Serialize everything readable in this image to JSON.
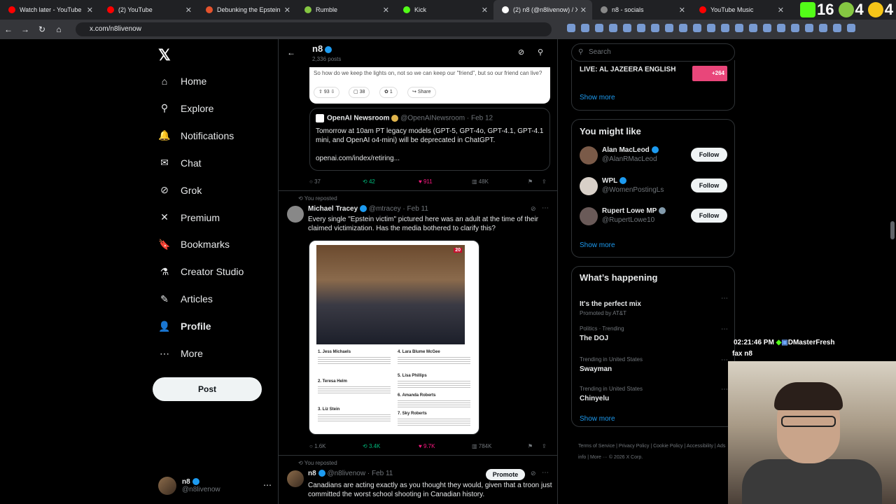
{
  "tabs": [
    {
      "label": "Watch later - YouTube",
      "color": "#ff0000"
    },
    {
      "label": "(2) YouTube",
      "color": "#ff0000"
    },
    {
      "label": "Debunking the Epstein My",
      "color": "#e5532d"
    },
    {
      "label": "Rumble",
      "color": "#85c742"
    },
    {
      "label": "Kick",
      "color": "#53fc18"
    },
    {
      "label": "(2) n8 (@n8livenow) / X",
      "color": "#ffffff",
      "active": true
    },
    {
      "label": "n8 - socials",
      "color": "#888888"
    },
    {
      "label": "YouTube Music",
      "color": "#ff0000"
    }
  ],
  "stream_counts": {
    "kick": "16",
    "rumble": "4",
    "other": "4"
  },
  "url": "x.com/n8livenow",
  "sidebar": {
    "items": [
      {
        "label": "Home",
        "icon": "home-icon",
        "glyph": "⌂"
      },
      {
        "label": "Explore",
        "icon": "search-icon",
        "glyph": "⚲"
      },
      {
        "label": "Notifications",
        "icon": "bell-icon",
        "glyph": "🔔",
        "badge": "2"
      },
      {
        "label": "Chat",
        "icon": "mail-icon",
        "glyph": "✉"
      },
      {
        "label": "Grok",
        "icon": "grok-icon",
        "glyph": "⊘"
      },
      {
        "label": "Premium",
        "icon": "x-icon",
        "glyph": "✕"
      },
      {
        "label": "Bookmarks",
        "icon": "bookmark-icon",
        "glyph": "🔖"
      },
      {
        "label": "Creator Studio",
        "icon": "flask-icon",
        "glyph": "⚗"
      },
      {
        "label": "Articles",
        "icon": "article-icon",
        "glyph": "✎"
      },
      {
        "label": "Profile",
        "icon": "person-icon",
        "glyph": "👤",
        "bold": true
      },
      {
        "label": "More",
        "icon": "more-icon",
        "glyph": "⋯"
      }
    ],
    "post_label": "Post",
    "account": {
      "name": "n8",
      "handle": "@n8livenow"
    }
  },
  "header": {
    "title": "n8",
    "subtitle": "2,336 posts"
  },
  "card_question": "So how do we keep the lights on, not so we can keep our \"friend\", but so our friend can live?",
  "card_pills": {
    "votes": "93",
    "comments": "38",
    "reacts": "1",
    "share": "Share"
  },
  "quote": {
    "name": "OpenAI Newsroom",
    "handle": "@OpenAINewsroom · Feb 12",
    "text": "Tomorrow at 10am PT legacy models (GPT-5, GPT-4o, GPT-4.1, GPT-4.1 mini, and OpenAI o4-mini) will be deprecated in ChatGPT.",
    "link": "openai.com/index/retiring..."
  },
  "actions1": {
    "reply": "37",
    "repost": "42",
    "like": "911",
    "views": "48K"
  },
  "post2": {
    "repost_label": "You reposted",
    "name": "Michael Tracey",
    "handle": "@mtracey · Feb 11",
    "text": "Every single \"Epstein victim\" pictured here was an adult at the time of their claimed victimization. Has the media bothered to clarify this?",
    "photo_badge": "20",
    "names": [
      "1. Jess Michaels",
      "2. Teresa Helm",
      "3. Liz Stein",
      "4. Lara Blume McGee",
      "5. Lisa Phillips",
      "6. Amanda Roberts",
      "7. Sky Roberts"
    ]
  },
  "actions2": {
    "reply": "1.6K",
    "repost": "3.4K",
    "like": "9.7K",
    "views": "784K"
  },
  "post3": {
    "repost_label": "You reposted",
    "name": "n8",
    "handle": "@n8livenow · Feb 11",
    "promote": "Promote",
    "text": "Canadians are acting exactly as you thought they would, given that a troon just committed the worst school shooting in Canadian history."
  },
  "right": {
    "search_placeholder": "Search",
    "live_label": "LIVE: AL JAZEERA ENGLISH",
    "live_count": "+264",
    "show_more": "Show more",
    "you_might_like": "You might like",
    "follow": "Follow",
    "people": [
      {
        "name": "Alan MacLeod",
        "handle": "@AlanRMacLeod",
        "color": "#7a5a48"
      },
      {
        "name": "WPL",
        "handle": "@WomenPostingLs",
        "color": "#d8d0c8"
      },
      {
        "name": "Rupert Lowe MP",
        "handle": "@RupertLowe10",
        "color": "#6a5a58"
      }
    ],
    "whats_happening": "What’s happening",
    "trends": [
      {
        "category": "",
        "name": "It's the perfect mix",
        "promo": "Promoted by AT&T"
      },
      {
        "category": "Politics · Trending",
        "name": "The DOJ"
      },
      {
        "category": "Trending in United States",
        "name": "Swayman"
      },
      {
        "category": "Trending in United States",
        "name": "Chinyelu"
      }
    ],
    "footer": "Terms of Service  |  Privacy Policy  |  Cookie Policy  |  Accessibility  |  Ads info  |  More ···  © 2026 X Corp."
  },
  "overlay": {
    "time": "02:21:46 PM",
    "user": "DMasterFresh",
    "chat": "fax n8"
  }
}
